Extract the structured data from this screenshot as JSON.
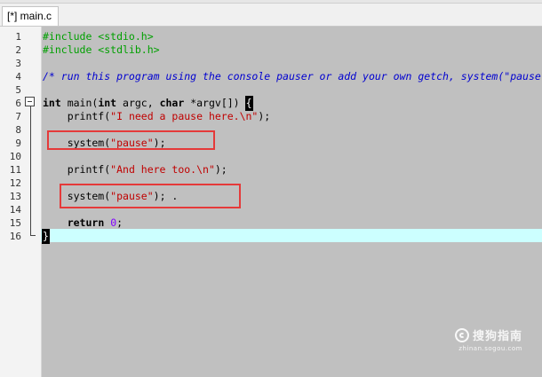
{
  "tab": {
    "label": "[*] main.c"
  },
  "gutter": {
    "line_numbers": [
      "1",
      "2",
      "3",
      "4",
      "5",
      "6",
      "7",
      "8",
      "9",
      "10",
      "11",
      "12",
      "13",
      "14",
      "15",
      "16"
    ]
  },
  "code": {
    "l1": "#include <stdio.h>",
    "l2": "#include <stdlib.h>",
    "l4": "/* run this program using the console pauser or add your own getch, system(\"pause\") or input loop */",
    "l6_kw1": "int",
    "l6_t1": " main(",
    "l6_kw2": "int",
    "l6_t2": " argc, ",
    "l6_kw3": "char",
    "l6_t3": " *argv[]) ",
    "l6_brace": "{",
    "l7_indent": "    printf(",
    "l7_str": "\"I need a pause here.\\n\"",
    "l7_end": ");",
    "l9_a": "    system(",
    "l9_str": "\"pause\"",
    "l9_end": ");",
    "l11_a": "    printf(",
    "l11_str": "\"And here too.\\n\"",
    "l11_end": ");",
    "l13_a": "    system(",
    "l13_str": "\"pause\"",
    "l13_end": "); .",
    "l15_a": "    ",
    "l15_kw": "return",
    "l15_sp": " ",
    "l15_num": "0",
    "l15_end": ";",
    "l16_brace": "}"
  },
  "watermark": {
    "text": "搜狗指南",
    "sub": "zhinan.sogou.com"
  },
  "colors": {
    "editor_bg": "#c0c0c0",
    "preprocessor": "#00a000",
    "comment": "#0000d0",
    "string": "#c00000",
    "number": "#8000ff",
    "current_line": "#ccffff",
    "annotation_box": "#e53a3a"
  }
}
